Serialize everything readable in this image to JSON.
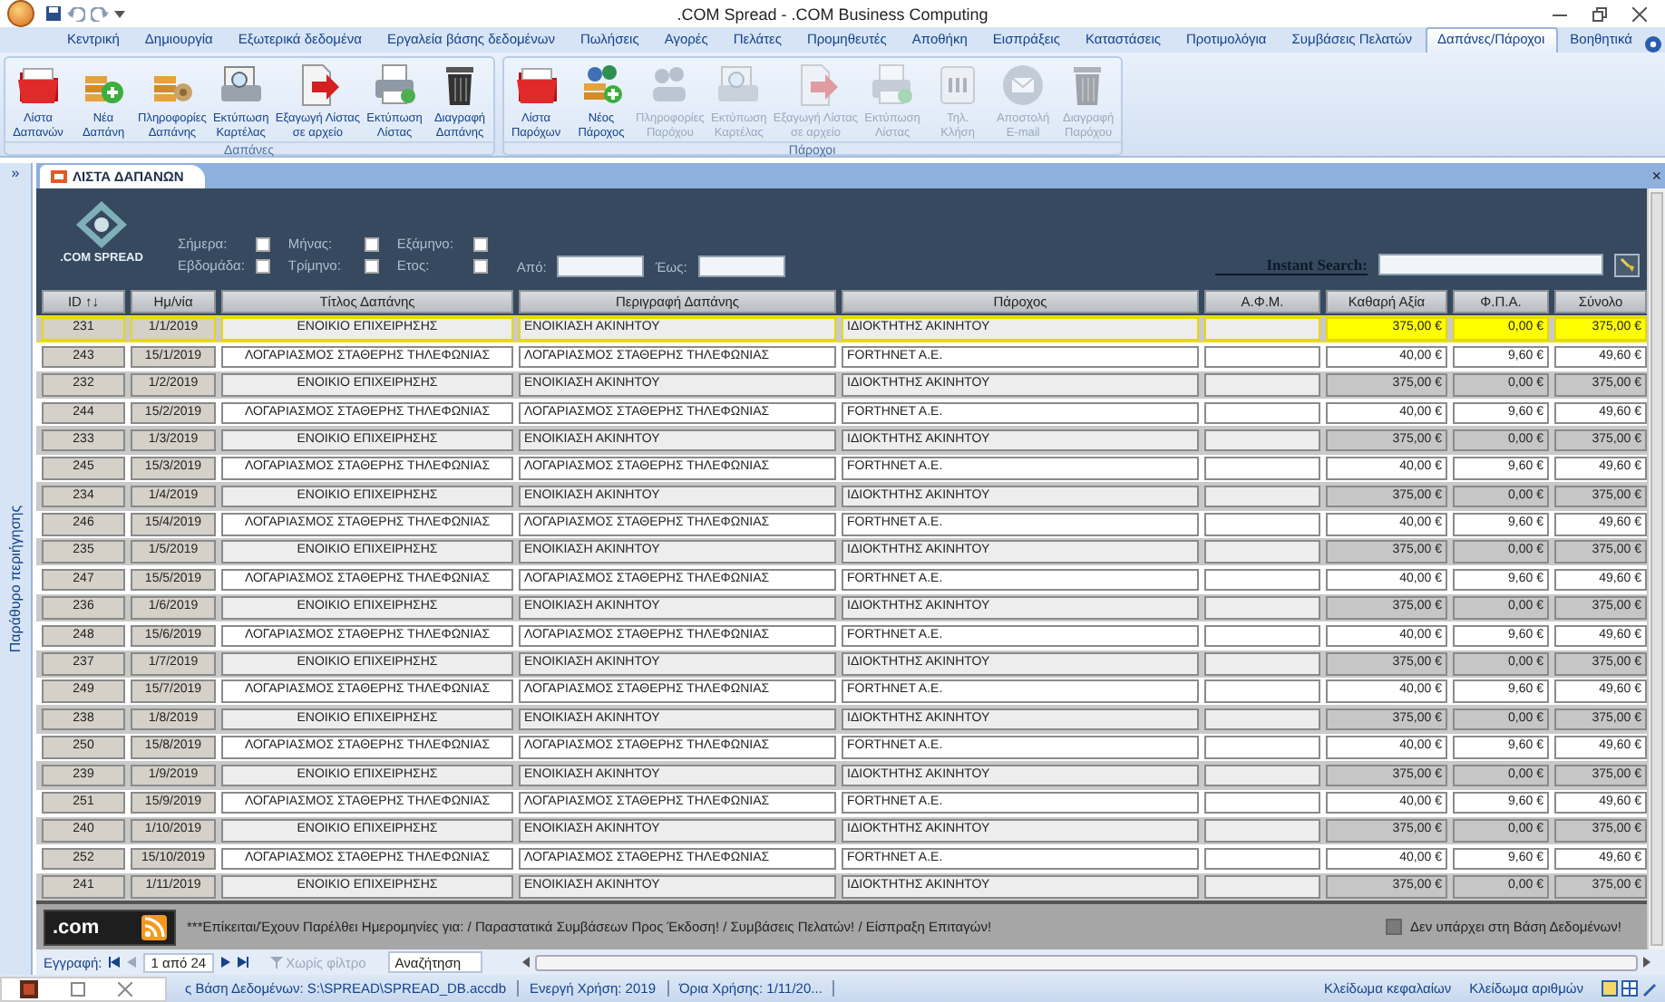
{
  "window": {
    "title": ".COM Spread - .COM Business Computing"
  },
  "ribbon_tabs": [
    {
      "label": "Κεντρική",
      "selected": false
    },
    {
      "label": "Δημιουργία",
      "selected": false
    },
    {
      "label": "Εξωτερικά δεδομένα",
      "selected": false
    },
    {
      "label": "Εργαλεία βάσης δεδομένων",
      "selected": false
    },
    {
      "label": "Πωλήσεις",
      "selected": false
    },
    {
      "label": "Αγορές",
      "selected": false
    },
    {
      "label": "Πελάτες",
      "selected": false
    },
    {
      "label": "Προμηθευτές",
      "selected": false
    },
    {
      "label": "Αποθήκη",
      "selected": false
    },
    {
      "label": "Εισπράξεις",
      "selected": false
    },
    {
      "label": "Καταστάσεις",
      "selected": false
    },
    {
      "label": "Προτιμολόγια",
      "selected": false
    },
    {
      "label": "Συμβάσεις Πελατών",
      "selected": false
    },
    {
      "label": "Δαπάνες/Πάροχοι",
      "selected": true
    },
    {
      "label": "Βοηθητικά",
      "selected": false
    }
  ],
  "ribbon_groups": [
    {
      "label": "Δαπάνες",
      "buttons": [
        {
          "lines": [
            "Λίστα",
            "Δαπανών"
          ],
          "disabled": false
        },
        {
          "lines": [
            "Νέα",
            "Δαπάνη"
          ],
          "disabled": false
        },
        {
          "lines": [
            "Πληροφορίες",
            "Δαπάνης"
          ],
          "disabled": false
        },
        {
          "lines": [
            "Εκτύπωση",
            "Καρτέλας"
          ],
          "disabled": false
        },
        {
          "lines": [
            "Εξαγωγή Λίστας",
            "σε αρχείο"
          ],
          "disabled": false
        },
        {
          "lines": [
            "Εκτύπωση",
            "Λίστας"
          ],
          "disabled": false
        },
        {
          "lines": [
            "Διαγραφή",
            "Δαπάνης"
          ],
          "disabled": false
        }
      ]
    },
    {
      "label": "Πάροχοι",
      "buttons": [
        {
          "lines": [
            "Λίστα",
            "Παρόχων"
          ],
          "disabled": false
        },
        {
          "lines": [
            "Νέος",
            "Πάροχος"
          ],
          "disabled": false
        },
        {
          "lines": [
            "Πληροφορίες",
            "Παρόχου"
          ],
          "disabled": true
        },
        {
          "lines": [
            "Εκτύπωση",
            "Καρτέλας"
          ],
          "disabled": true
        },
        {
          "lines": [
            "Εξαγωγή Λίστας",
            "σε αρχείο"
          ],
          "disabled": true
        },
        {
          "lines": [
            "Εκτύπωση",
            "Λίστας"
          ],
          "disabled": true
        },
        {
          "lines": [
            "Τηλ.",
            "Κλήση"
          ],
          "disabled": true
        },
        {
          "lines": [
            "Αποστολή",
            "E-mail"
          ],
          "disabled": true
        },
        {
          "lines": [
            "Διαγραφή",
            "Παρόχου"
          ],
          "disabled": true
        }
      ]
    }
  ],
  "nav_pane": {
    "toggle": "»",
    "label": "Παράθυρο περιήγησης"
  },
  "document_tab": {
    "label": "ΛΙΣΤΑ ΔΑΠΑΝΩΝ",
    "close": "×"
  },
  "header": {
    "logo_text": ".COM SPREAD",
    "periods": [
      {
        "label": "Σήμερα:",
        "checked": false
      },
      {
        "label": "Μήνας:",
        "checked": false
      },
      {
        "label": "Εξάμηνο:",
        "checked": false
      },
      {
        "label": "Εβδομάδα:",
        "checked": false
      },
      {
        "label": "Τρίμηνο:",
        "checked": false
      },
      {
        "label": "Ετος:",
        "checked": false
      }
    ],
    "from_label": "Από:",
    "to_label": "Έως:",
    "search_label": "Instant Search:"
  },
  "table": {
    "columns": [
      "ID ↑↓",
      "Ημ/νία",
      "Τίτλος Δαπάνης",
      "Περιγραφή Δαπάνης",
      "Πάροχος",
      "Α.Φ.Μ.",
      "Καθαρή Αξία",
      "Φ.Π.Α.",
      "Σύνολο"
    ],
    "rows": [
      {
        "id": "231",
        "date": "1/1/2019",
        "title": "ΕΝΟΙΚΙΟ ΕΠΙΧΕΙΡΗΣΗΣ",
        "description": "ΕΝΟΙΚΙΑΣΗ ΑΚΙΝΗΤΟΥ",
        "supplier": "ΙΔΙΟΚΤΗΤΗΣ ΑΚΙΝΗΤΟΥ",
        "net": "375,00 €",
        "vat": "0,00 €",
        "total": "375,00 €",
        "selected": true
      },
      {
        "id": "243",
        "date": "15/1/2019",
        "title": "ΛΟΓΑΡΙΑΣΜΟΣ ΣΤΑΘΕΡΗΣ ΤΗΛΕΦΩΝΙΑΣ",
        "description": "ΛΟΓΑΡΙΑΣΜΟΣ ΣΤΑΘΕΡΗΣ ΤΗΛΕΦΩΝΙΑΣ",
        "supplier": "FORTHNET A.E.",
        "net": "40,00 €",
        "vat": "9,60 €",
        "total": "49,60 €",
        "selected": false
      },
      {
        "id": "232",
        "date": "1/2/2019",
        "title": "ΕΝΟΙΚΙΟ ΕΠΙΧΕΙΡΗΣΗΣ",
        "description": "ΕΝΟΙΚΙΑΣΗ ΑΚΙΝΗΤΟΥ",
        "supplier": "ΙΔΙΟΚΤΗΤΗΣ ΑΚΙΝΗΤΟΥ",
        "net": "375,00 €",
        "vat": "0,00 €",
        "total": "375,00 €",
        "selected": false
      },
      {
        "id": "244",
        "date": "15/2/2019",
        "title": "ΛΟΓΑΡΙΑΣΜΟΣ ΣΤΑΘΕΡΗΣ ΤΗΛΕΦΩΝΙΑΣ",
        "description": "ΛΟΓΑΡΙΑΣΜΟΣ ΣΤΑΘΕΡΗΣ ΤΗΛΕΦΩΝΙΑΣ",
        "supplier": "FORTHNET A.E.",
        "net": "40,00 €",
        "vat": "9,60 €",
        "total": "49,60 €",
        "selected": false
      },
      {
        "id": "233",
        "date": "1/3/2019",
        "title": "ΕΝΟΙΚΙΟ ΕΠΙΧΕΙΡΗΣΗΣ",
        "description": "ΕΝΟΙΚΙΑΣΗ ΑΚΙΝΗΤΟΥ",
        "supplier": "ΙΔΙΟΚΤΗΤΗΣ ΑΚΙΝΗΤΟΥ",
        "net": "375,00 €",
        "vat": "0,00 €",
        "total": "375,00 €",
        "selected": false
      },
      {
        "id": "245",
        "date": "15/3/2019",
        "title": "ΛΟΓΑΡΙΑΣΜΟΣ ΣΤΑΘΕΡΗΣ ΤΗΛΕΦΩΝΙΑΣ",
        "description": "ΛΟΓΑΡΙΑΣΜΟΣ ΣΤΑΘΕΡΗΣ ΤΗΛΕΦΩΝΙΑΣ",
        "supplier": "FORTHNET A.E.",
        "net": "40,00 €",
        "vat": "9,60 €",
        "total": "49,60 €",
        "selected": false
      },
      {
        "id": "234",
        "date": "1/4/2019",
        "title": "ΕΝΟΙΚΙΟ ΕΠΙΧΕΙΡΗΣΗΣ",
        "description": "ΕΝΟΙΚΙΑΣΗ ΑΚΙΝΗΤΟΥ",
        "supplier": "ΙΔΙΟΚΤΗΤΗΣ ΑΚΙΝΗΤΟΥ",
        "net": "375,00 €",
        "vat": "0,00 €",
        "total": "375,00 €",
        "selected": false
      },
      {
        "id": "246",
        "date": "15/4/2019",
        "title": "ΛΟΓΑΡΙΑΣΜΟΣ ΣΤΑΘΕΡΗΣ ΤΗΛΕΦΩΝΙΑΣ",
        "description": "ΛΟΓΑΡΙΑΣΜΟΣ ΣΤΑΘΕΡΗΣ ΤΗΛΕΦΩΝΙΑΣ",
        "supplier": "FORTHNET A.E.",
        "net": "40,00 €",
        "vat": "9,60 €",
        "total": "49,60 €",
        "selected": false
      },
      {
        "id": "235",
        "date": "1/5/2019",
        "title": "ΕΝΟΙΚΙΟ ΕΠΙΧΕΙΡΗΣΗΣ",
        "description": "ΕΝΟΙΚΙΑΣΗ ΑΚΙΝΗΤΟΥ",
        "supplier": "ΙΔΙΟΚΤΗΤΗΣ ΑΚΙΝΗΤΟΥ",
        "net": "375,00 €",
        "vat": "0,00 €",
        "total": "375,00 €",
        "selected": false
      },
      {
        "id": "247",
        "date": "15/5/2019",
        "title": "ΛΟΓΑΡΙΑΣΜΟΣ ΣΤΑΘΕΡΗΣ ΤΗΛΕΦΩΝΙΑΣ",
        "description": "ΛΟΓΑΡΙΑΣΜΟΣ ΣΤΑΘΕΡΗΣ ΤΗΛΕΦΩΝΙΑΣ",
        "supplier": "FORTHNET A.E.",
        "net": "40,00 €",
        "vat": "9,60 €",
        "total": "49,60 €",
        "selected": false
      },
      {
        "id": "236",
        "date": "1/6/2019",
        "title": "ΕΝΟΙΚΙΟ ΕΠΙΧΕΙΡΗΣΗΣ",
        "description": "ΕΝΟΙΚΙΑΣΗ ΑΚΙΝΗΤΟΥ",
        "supplier": "ΙΔΙΟΚΤΗΤΗΣ ΑΚΙΝΗΤΟΥ",
        "net": "375,00 €",
        "vat": "0,00 €",
        "total": "375,00 €",
        "selected": false
      },
      {
        "id": "248",
        "date": "15/6/2019",
        "title": "ΛΟΓΑΡΙΑΣΜΟΣ ΣΤΑΘΕΡΗΣ ΤΗΛΕΦΩΝΙΑΣ",
        "description": "ΛΟΓΑΡΙΑΣΜΟΣ ΣΤΑΘΕΡΗΣ ΤΗΛΕΦΩΝΙΑΣ",
        "supplier": "FORTHNET A.E.",
        "net": "40,00 €",
        "vat": "9,60 €",
        "total": "49,60 €",
        "selected": false
      },
      {
        "id": "237",
        "date": "1/7/2019",
        "title": "ΕΝΟΙΚΙΟ ΕΠΙΧΕΙΡΗΣΗΣ",
        "description": "ΕΝΟΙΚΙΑΣΗ ΑΚΙΝΗΤΟΥ",
        "supplier": "ΙΔΙΟΚΤΗΤΗΣ ΑΚΙΝΗΤΟΥ",
        "net": "375,00 €",
        "vat": "0,00 €",
        "total": "375,00 €",
        "selected": false
      },
      {
        "id": "249",
        "date": "15/7/2019",
        "title": "ΛΟΓΑΡΙΑΣΜΟΣ ΣΤΑΘΕΡΗΣ ΤΗΛΕΦΩΝΙΑΣ",
        "description": "ΛΟΓΑΡΙΑΣΜΟΣ ΣΤΑΘΕΡΗΣ ΤΗΛΕΦΩΝΙΑΣ",
        "supplier": "FORTHNET A.E.",
        "net": "40,00 €",
        "vat": "9,60 €",
        "total": "49,60 €",
        "selected": false
      },
      {
        "id": "238",
        "date": "1/8/2019",
        "title": "ΕΝΟΙΚΙΟ ΕΠΙΧΕΙΡΗΣΗΣ",
        "description": "ΕΝΟΙΚΙΑΣΗ ΑΚΙΝΗΤΟΥ",
        "supplier": "ΙΔΙΟΚΤΗΤΗΣ ΑΚΙΝΗΤΟΥ",
        "net": "375,00 €",
        "vat": "0,00 €",
        "total": "375,00 €",
        "selected": false
      },
      {
        "id": "250",
        "date": "15/8/2019",
        "title": "ΛΟΓΑΡΙΑΣΜΟΣ ΣΤΑΘΕΡΗΣ ΤΗΛΕΦΩΝΙΑΣ",
        "description": "ΛΟΓΑΡΙΑΣΜΟΣ ΣΤΑΘΕΡΗΣ ΤΗΛΕΦΩΝΙΑΣ",
        "supplier": "FORTHNET A.E.",
        "net": "40,00 €",
        "vat": "9,60 €",
        "total": "49,60 €",
        "selected": false
      },
      {
        "id": "239",
        "date": "1/9/2019",
        "title": "ΕΝΟΙΚΙΟ ΕΠΙΧΕΙΡΗΣΗΣ",
        "description": "ΕΝΟΙΚΙΑΣΗ ΑΚΙΝΗΤΟΥ",
        "supplier": "ΙΔΙΟΚΤΗΤΗΣ ΑΚΙΝΗΤΟΥ",
        "net": "375,00 €",
        "vat": "0,00 €",
        "total": "375,00 €",
        "selected": false
      },
      {
        "id": "251",
        "date": "15/9/2019",
        "title": "ΛΟΓΑΡΙΑΣΜΟΣ ΣΤΑΘΕΡΗΣ ΤΗΛΕΦΩΝΙΑΣ",
        "description": "ΛΟΓΑΡΙΑΣΜΟΣ ΣΤΑΘΕΡΗΣ ΤΗΛΕΦΩΝΙΑΣ",
        "supplier": "FORTHNET A.E.",
        "net": "40,00 €",
        "vat": "9,60 €",
        "total": "49,60 €",
        "selected": false
      },
      {
        "id": "240",
        "date": "1/10/2019",
        "title": "ΕΝΟΙΚΙΟ ΕΠΙΧΕΙΡΗΣΗΣ",
        "description": "ΕΝΟΙΚΙΑΣΗ ΑΚΙΝΗΤΟΥ",
        "supplier": "ΙΔΙΟΚΤΗΤΗΣ ΑΚΙΝΗΤΟΥ",
        "net": "375,00 €",
        "vat": "0,00 €",
        "total": "375,00 €",
        "selected": false
      },
      {
        "id": "252",
        "date": "15/10/2019",
        "title": "ΛΟΓΑΡΙΑΣΜΟΣ ΣΤΑΘΕΡΗΣ ΤΗΛΕΦΩΝΙΑΣ",
        "description": "ΛΟΓΑΡΙΑΣΜΟΣ ΣΤΑΘΕΡΗΣ ΤΗΛΕΦΩΝΙΑΣ",
        "supplier": "FORTHNET A.E.",
        "net": "40,00 €",
        "vat": "9,60 €",
        "total": "49,60 €",
        "selected": false
      },
      {
        "id": "241",
        "date": "1/11/2019",
        "title": "ΕΝΟΙΚΙΟ ΕΠΙΧΕΙΡΗΣΗΣ",
        "description": "ΕΝΟΙΚΙΑΣΗ ΑΚΙΝΗΤΟΥ",
        "supplier": "ΙΔΙΟΚΤΗΤΗΣ ΑΚΙΝΗΤΟΥ",
        "net": "375,00 €",
        "vat": "0,00 €",
        "total": "375,00 €",
        "selected": false
      }
    ]
  },
  "footer": {
    "logo_text": ".com",
    "notice": "***Επίκειται/Έχουν Παρέλθει Ημερομηνίες για:  / Παραστατικά Συμβάσεων Προς Έκδοση! / Συμβάσεις Πελατών! / Είσπραξη Επιταγών!",
    "legend": {
      "label": "Δεν υπάρχει στη Βάση Δεδομένων!",
      "color": "#7a7a7a"
    }
  },
  "record_nav": {
    "label": "Εγγραφή:",
    "position": "1 από 24",
    "filter": "Χωρίς φίλτρο",
    "search": "Αναζήτηση"
  },
  "status_bar": {
    "items": [
      "ς Βάση Δεδομένων: S:\\SPREAD\\SPREAD_DB.accdb",
      "Ενεργή Χρήση: 2019",
      "Όρια Χρήσης: 1/11/20..."
    ],
    "right": [
      "Κλείδωμα κεφαλαίων",
      "Κλείδωμα αριθμών"
    ]
  }
}
